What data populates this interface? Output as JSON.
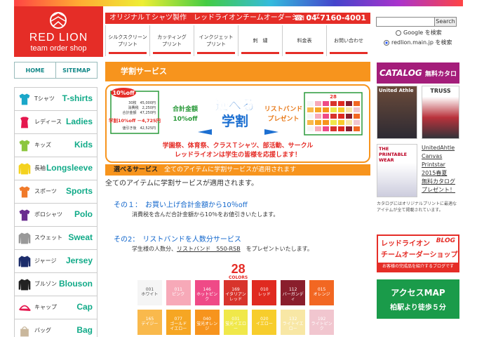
{
  "header": {
    "logo_line1": "RED LION",
    "logo_line2": "team order shop",
    "tagline": "オリジナルＴシャツ製作　レッドライオンチームオーダーショップ",
    "phone": "☎ 04-7160-4001",
    "nav": [
      {
        "label": "シルクスクリーン\nプリント"
      },
      {
        "label": "カッティング\nプリント"
      },
      {
        "label": "インクジェット\nプリント"
      },
      {
        "label": "刺　繍"
      },
      {
        "label": "料金表"
      },
      {
        "label": "お問い合わせ"
      }
    ]
  },
  "search": {
    "button": "Search",
    "option1": "Google を検索",
    "option2": "redlion.main.jp を検索"
  },
  "left": {
    "home": "HOME",
    "sitemap": "SITEMAP",
    "categories": [
      {
        "jp": "Tシャツ",
        "en": "T-shirts",
        "color": "#1aa7c9",
        "shape": "tshirt"
      },
      {
        "jp": "レディース",
        "en": "Ladies",
        "color": "#e5174e",
        "shape": "ladies"
      },
      {
        "jp": "キッズ",
        "en": "Kids",
        "color": "#8cc63e",
        "shape": "tshirt"
      },
      {
        "jp": "長袖",
        "en": "Longsleeve",
        "color": "#f4d21f",
        "shape": "long"
      },
      {
        "jp": "スポーツ",
        "en": "Sports",
        "color": "#f07a2a",
        "shape": "tshirt"
      },
      {
        "jp": "ポロシャツ",
        "en": "Polo",
        "color": "#6a2c8f",
        "shape": "tshirt"
      },
      {
        "jp": "スウェット",
        "en": "Sweat",
        "color": "#999999",
        "shape": "long"
      },
      {
        "jp": "ジャージ",
        "en": "Jersey",
        "color": "#1c2d6b",
        "shape": "long"
      },
      {
        "jp": "ブルゾン",
        "en": "Blouson",
        "color": "#222222",
        "shape": "long"
      },
      {
        "jp": "キャップ",
        "en": "Cap",
        "color": "#e5174e",
        "shape": "cap"
      },
      {
        "jp": "バッグ",
        "en": "Bag",
        "color": "#c9b79c",
        "shape": "bag"
      }
    ]
  },
  "main": {
    "title": "学割サービス",
    "banner": {
      "pct_badge": "10%off",
      "calc_rows": [
        "30枚　45,000円",
        "消費税　2,250円",
        "合計金額　47,250円"
      ],
      "calc_discount": "学割10%off －4,725円",
      "calc_after": "値引き後　42,525円",
      "center_left": "合計金額\n10%off",
      "center_main": "選べる\n学割",
      "center_right": "リストバンド\nプレゼント",
      "count": "28",
      "foot1": "学園祭、体育祭、クラスＴシャツ、部活動、サークル",
      "foot2": "レッドライオンは学生の皆様を応援します！"
    },
    "sub_title": "選べるサービス",
    "sub_text": "全てのアイテムに学割サービスが適用されます",
    "lead": "全てのアイテムに学割サービスが適用されます。",
    "item1_title": "その１：　お買い上げ合計金額から10％off",
    "item1_text": "消費税を含んだ合計金額から10％をお値引きいたします。",
    "item2_title": "その2：　リストバンドを人数分サービス",
    "item2_text_a": "学生様の人数分、",
    "item2_link": "リストバンド　550-RSB",
    "item2_text_b": "をプレゼントいたします。",
    "colors_count": "28",
    "colors_label": "COLORS",
    "swatches": [
      {
        "code": "001",
        "name": "ホワイト",
        "color": "#f5f5f5",
        "dark": true
      },
      {
        "code": "011",
        "name": "ピンク",
        "color": "#f7a9b8"
      },
      {
        "code": "146",
        "name": "ホットピンク",
        "color": "#ef4a87"
      },
      {
        "code": "169",
        "name": "イタリアン\nレッド",
        "color": "#d8342c"
      },
      {
        "code": "010",
        "name": "レッド",
        "color": "#e02a20"
      },
      {
        "code": "112",
        "name": "バーガンディ",
        "color": "#8a1e2c"
      },
      {
        "code": "015",
        "name": "オレンジ",
        "color": "#f26722"
      },
      {
        "code": "165",
        "name": "デイジー",
        "color": "#f9b94c"
      },
      {
        "code": "077",
        "name": "ゴールド\nイエロー",
        "color": "#f6a623"
      },
      {
        "code": "040",
        "name": "蛍光オレンジ",
        "color": "#f7941d"
      },
      {
        "code": "031",
        "name": "蛍光イエロー",
        "color": "#f0e84a"
      },
      {
        "code": "020",
        "name": "イエロー",
        "color": "#f7cd2c"
      },
      {
        "code": "132",
        "name": "ライトイエロー",
        "color": "#f8e7a5"
      },
      {
        "code": "192",
        "name": "ライトピンク",
        "color": "#f1c6cf"
      }
    ]
  },
  "right": {
    "catalog_title": "CATALOG",
    "catalog_sub": "無料カタログ",
    "thumb1": "United Athle",
    "thumb2": "TRUSS",
    "thumb3": "THE PRINTABLE WEAR",
    "catalog_link": "UnitedAhtle\nCanvas\nPrintstar\n2015春夏\n無料カタログ\nプレゼント！",
    "catalog_note": "カタログにはオリジナルプリントに最適なアイテムが全て掲載されています。",
    "blog_line1": "レッドライオン",
    "blog_tag": "BLOG",
    "blog_line2": "チームオーダーショップ",
    "blog_line3": "お客様の完成品を紹介するブログです",
    "map_title": "アクセスMAP",
    "map_sub": "柏駅より徒歩５分"
  }
}
